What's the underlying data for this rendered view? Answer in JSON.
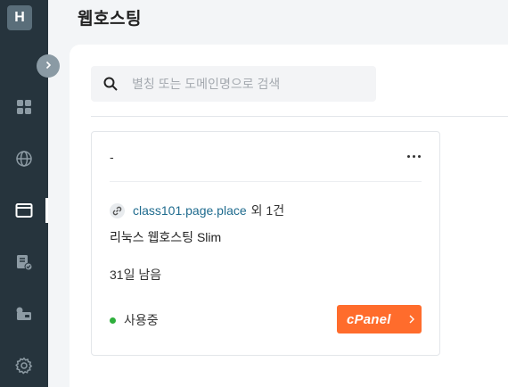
{
  "sidebar": {
    "logo": "H",
    "items": [
      {
        "name": "dashboard",
        "icon": "grid-icon"
      },
      {
        "name": "domains",
        "icon": "globe-icon"
      },
      {
        "name": "hosting",
        "icon": "browser-window-icon",
        "active": true
      },
      {
        "name": "billing",
        "icon": "document-check-icon"
      },
      {
        "name": "payment",
        "icon": "wallet-card-icon"
      },
      {
        "name": "settings",
        "icon": "gear-icon"
      }
    ],
    "collapse_icon": "chevron-right-icon"
  },
  "header": {
    "title": "웹호스팅"
  },
  "search": {
    "placeholder": "별칭 또는 도메인명으로 검색",
    "value": ""
  },
  "cards": [
    {
      "name": "-",
      "domain": "class101.page.place",
      "domain_extra": "외 1건",
      "product": "리눅스 웹호스팅 Slim",
      "days_left": "31일 남음",
      "status": "사용중",
      "status_color": "#2eaf3c",
      "panel_button": "cPanel",
      "panel_color": "#ff6c2c"
    }
  ],
  "colors": {
    "sidebar": "#26343d",
    "link": "#1f6b8e",
    "accent": "#ff6c2c"
  }
}
